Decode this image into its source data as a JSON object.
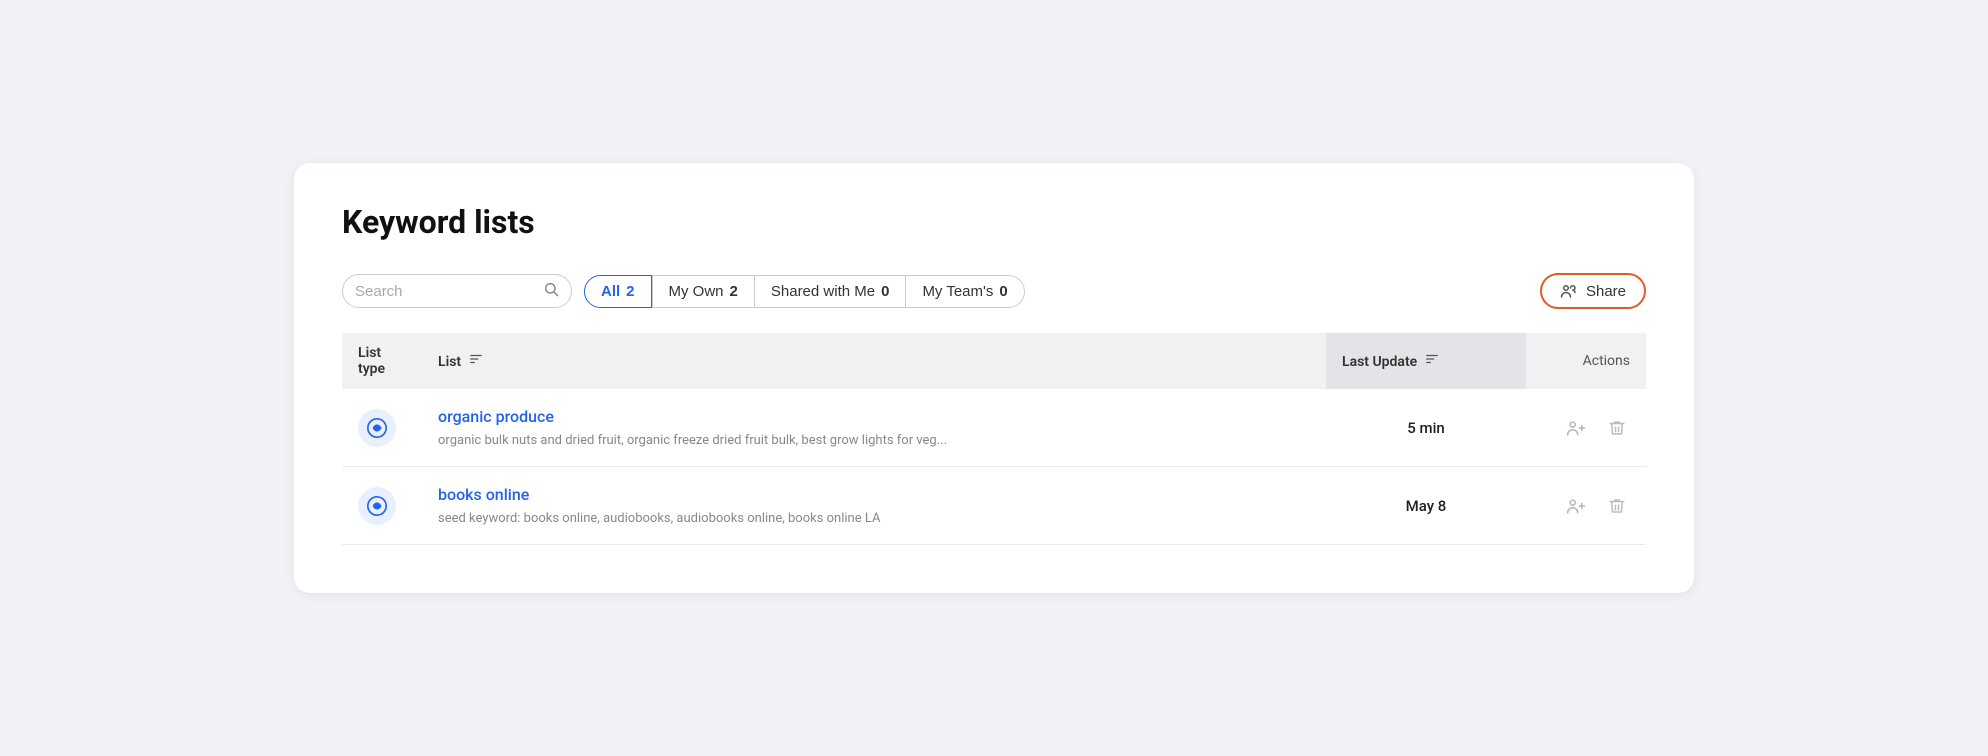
{
  "page": {
    "title": "Keyword lists"
  },
  "toolbar": {
    "search_placeholder": "Search",
    "share_label": "Share"
  },
  "filter_tabs": [
    {
      "id": "all",
      "label": "All",
      "count": "2",
      "active": true
    },
    {
      "id": "my-own",
      "label": "My Own",
      "count": "2",
      "active": false
    },
    {
      "id": "shared-with-me",
      "label": "Shared with Me",
      "count": "0",
      "active": false
    },
    {
      "id": "my-teams",
      "label": "My Team's",
      "count": "0",
      "active": false
    }
  ],
  "table": {
    "columns": [
      {
        "id": "list-type",
        "label": "List type"
      },
      {
        "id": "list",
        "label": "List"
      },
      {
        "id": "last-update",
        "label": "Last Update"
      },
      {
        "id": "actions",
        "label": "Actions"
      }
    ],
    "rows": [
      {
        "id": "row-1",
        "name": "organic produce",
        "description": "organic bulk nuts and dried fruit, organic freeze dried fruit bulk, best grow lights for veg...",
        "last_update": "5 min"
      },
      {
        "id": "row-2",
        "name": "books online",
        "description": "seed keyword: books online, audiobooks, audiobooks online, books online LA",
        "last_update": "May 8"
      }
    ]
  }
}
